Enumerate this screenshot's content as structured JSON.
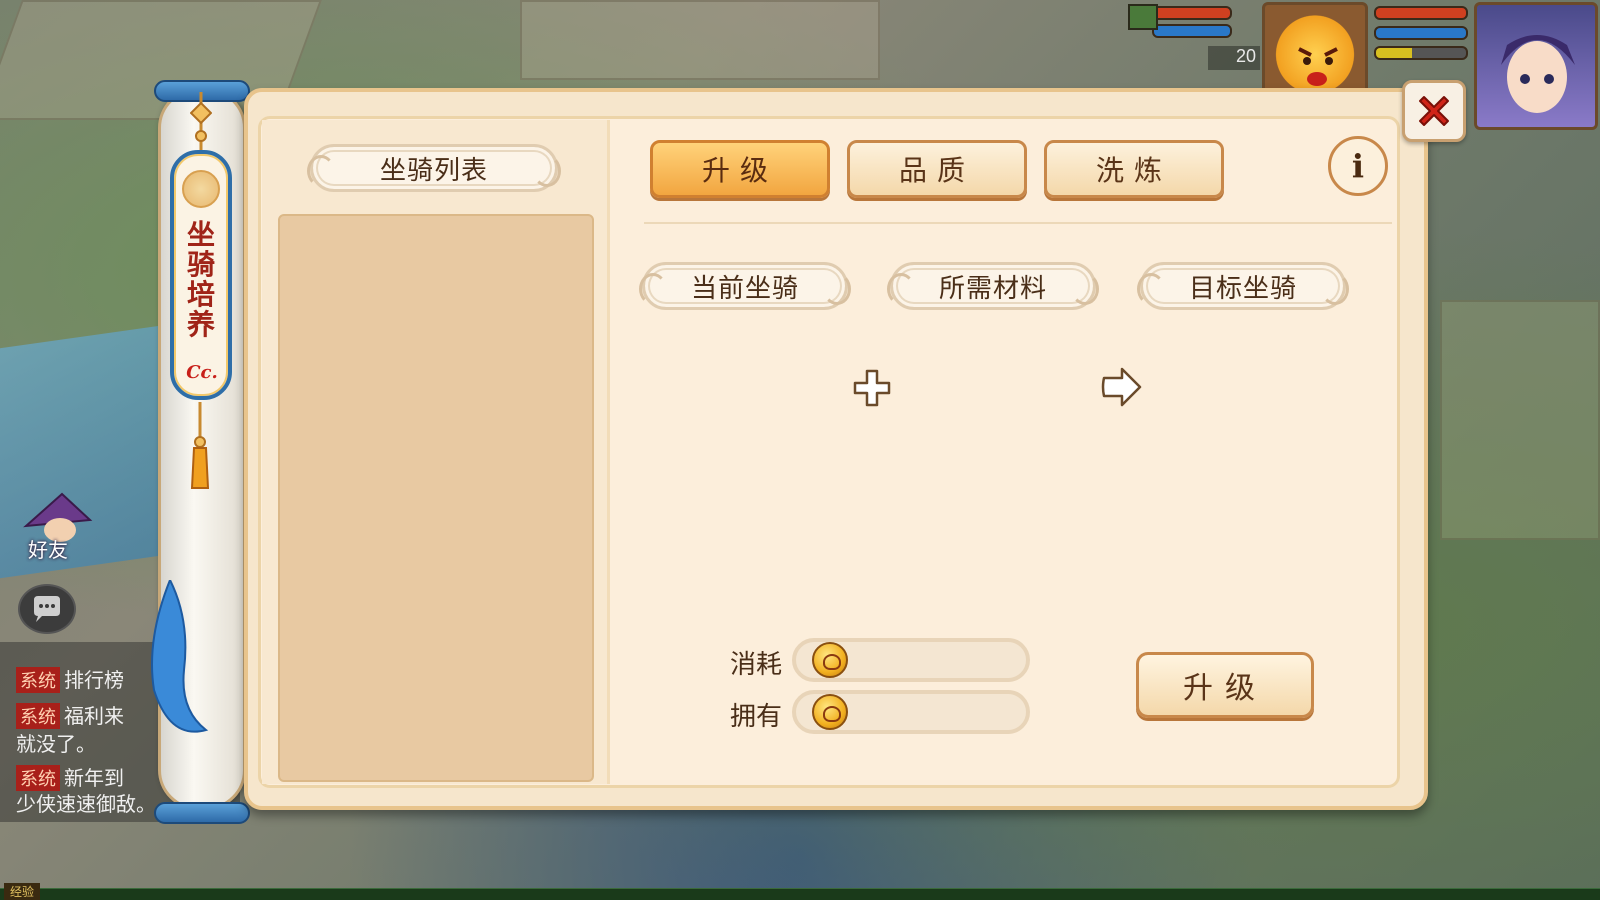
{
  "hud": {
    "level": "20"
  },
  "left_hud": {
    "friend_label": "好友",
    "chat": [
      {
        "tag": "系统",
        "text": "排行榜"
      },
      {
        "tag": "系统",
        "text": "福利来"
      },
      {
        "tag": "",
        "text": "就没了。"
      },
      {
        "tag": "系统",
        "text": "新年到"
      },
      {
        "tag": "",
        "text": "少侠速速御敌。"
      }
    ],
    "exp_label": "经验"
  },
  "banner": {
    "title": "坐骑培养",
    "mark": "Cc."
  },
  "panel": {
    "list_title": "坐骑列表",
    "tabs": [
      {
        "label": "升级",
        "active": true
      },
      {
        "label": "品质",
        "active": false
      },
      {
        "label": "洗炼",
        "active": false
      }
    ],
    "info_icon": "info-icon",
    "slots": {
      "current": "当前坐骑",
      "material": "所需材料",
      "target": "目标坐骑"
    },
    "cost": {
      "consume_label": "消耗",
      "consume_value": "",
      "own_label": "拥有",
      "own_value": ""
    },
    "upgrade_button": "升级",
    "close_icon": "close-icon"
  },
  "colors": {
    "accent": "#f2a640",
    "panel_bg": "#fceedb",
    "text": "#4a2e18",
    "close_red": "#d02418"
  }
}
